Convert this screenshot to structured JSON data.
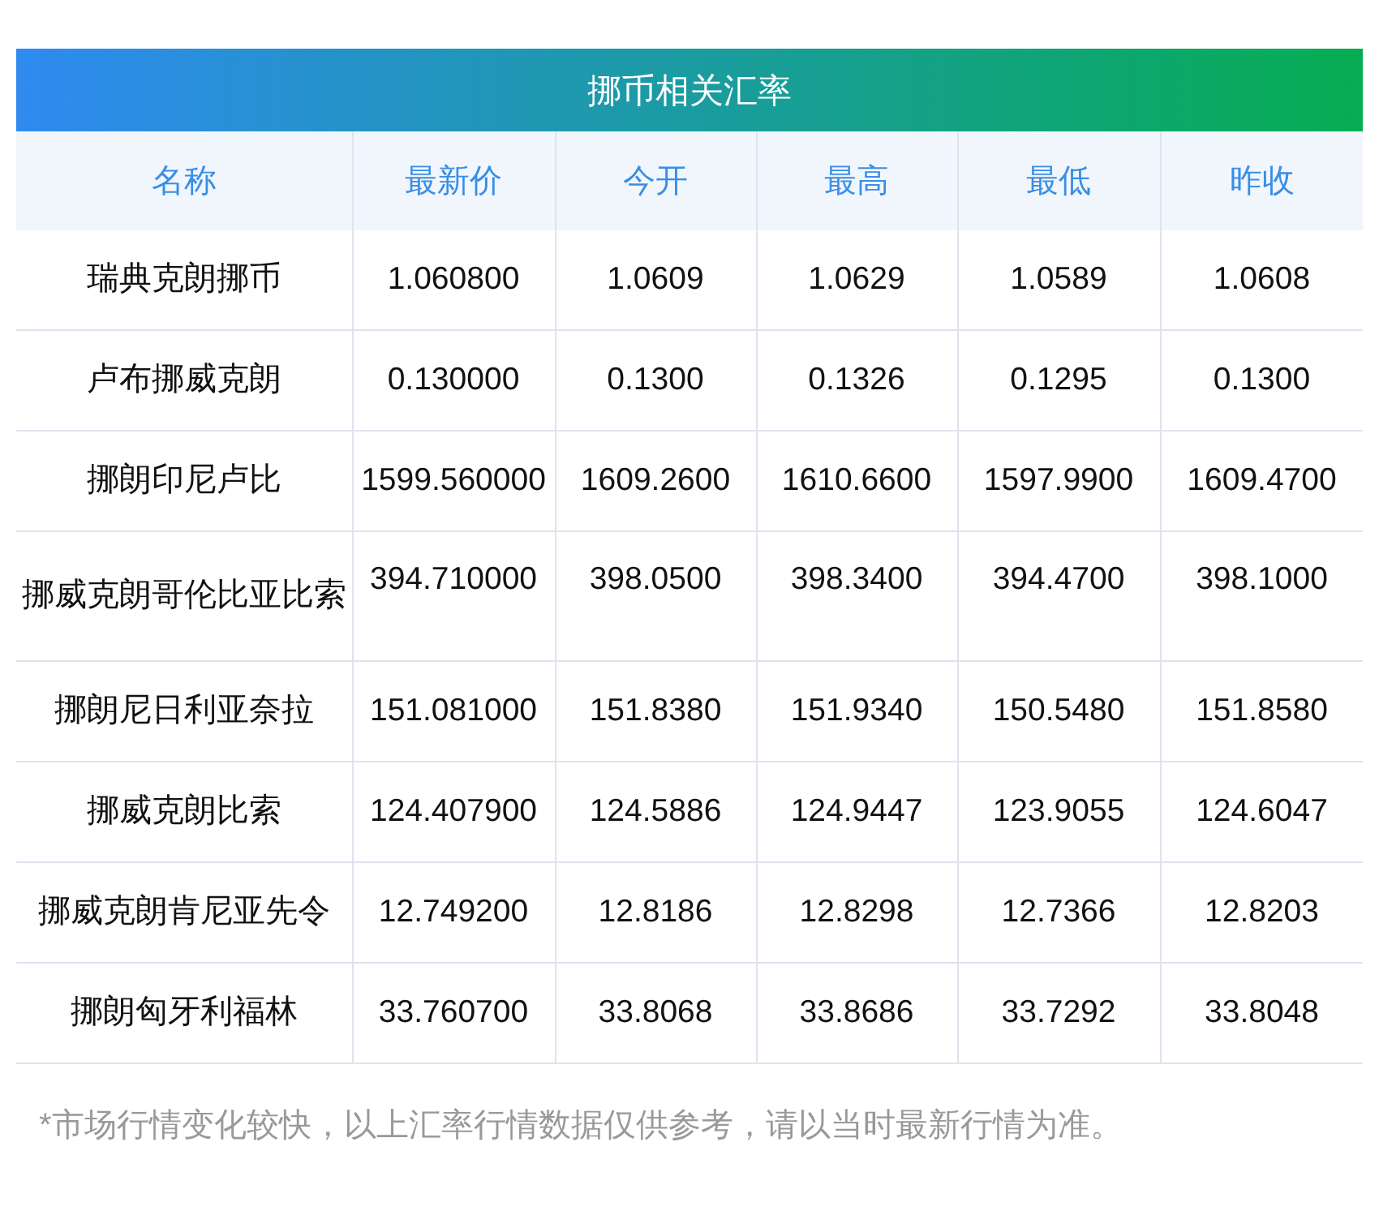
{
  "title": "挪币相关汇率",
  "columns": [
    "名称",
    "最新价",
    "今开",
    "最高",
    "最低",
    "昨收"
  ],
  "rows": [
    {
      "name": "瑞典克朗挪币",
      "values": [
        "1.060800",
        "1.0609",
        "1.0629",
        "1.0589",
        "1.0608"
      ]
    },
    {
      "name": "卢布挪威克朗",
      "values": [
        "0.130000",
        "0.1300",
        "0.1326",
        "0.1295",
        "0.1300"
      ]
    },
    {
      "name": "挪朗印尼卢比",
      "values": [
        "1599.560000",
        "1609.2600",
        "1610.6600",
        "1597.9900",
        "1609.4700"
      ]
    },
    {
      "name": "挪威克朗哥伦比亚比索",
      "values": [
        "394.710000",
        "398.0500",
        "398.3400",
        "394.4700",
        "398.1000"
      ]
    },
    {
      "name": "挪朗尼日利亚奈拉",
      "values": [
        "151.081000",
        "151.8380",
        "151.9340",
        "150.5480",
        "151.8580"
      ]
    },
    {
      "name": "挪威克朗比索",
      "values": [
        "124.407900",
        "124.5886",
        "124.9447",
        "123.9055",
        "124.6047"
      ]
    },
    {
      "name": "挪威克朗肯尼亚先令",
      "values": [
        "12.749200",
        "12.8186",
        "12.8298",
        "12.7366",
        "12.8203"
      ]
    },
    {
      "name": "挪朗匈牙利福林",
      "values": [
        "33.760700",
        "33.8068",
        "33.8686",
        "33.7292",
        "33.8048"
      ]
    }
  ],
  "note": "*市场行情变化较快，以上汇率行情数据仅供参考，请以当时最新行情为准。"
}
